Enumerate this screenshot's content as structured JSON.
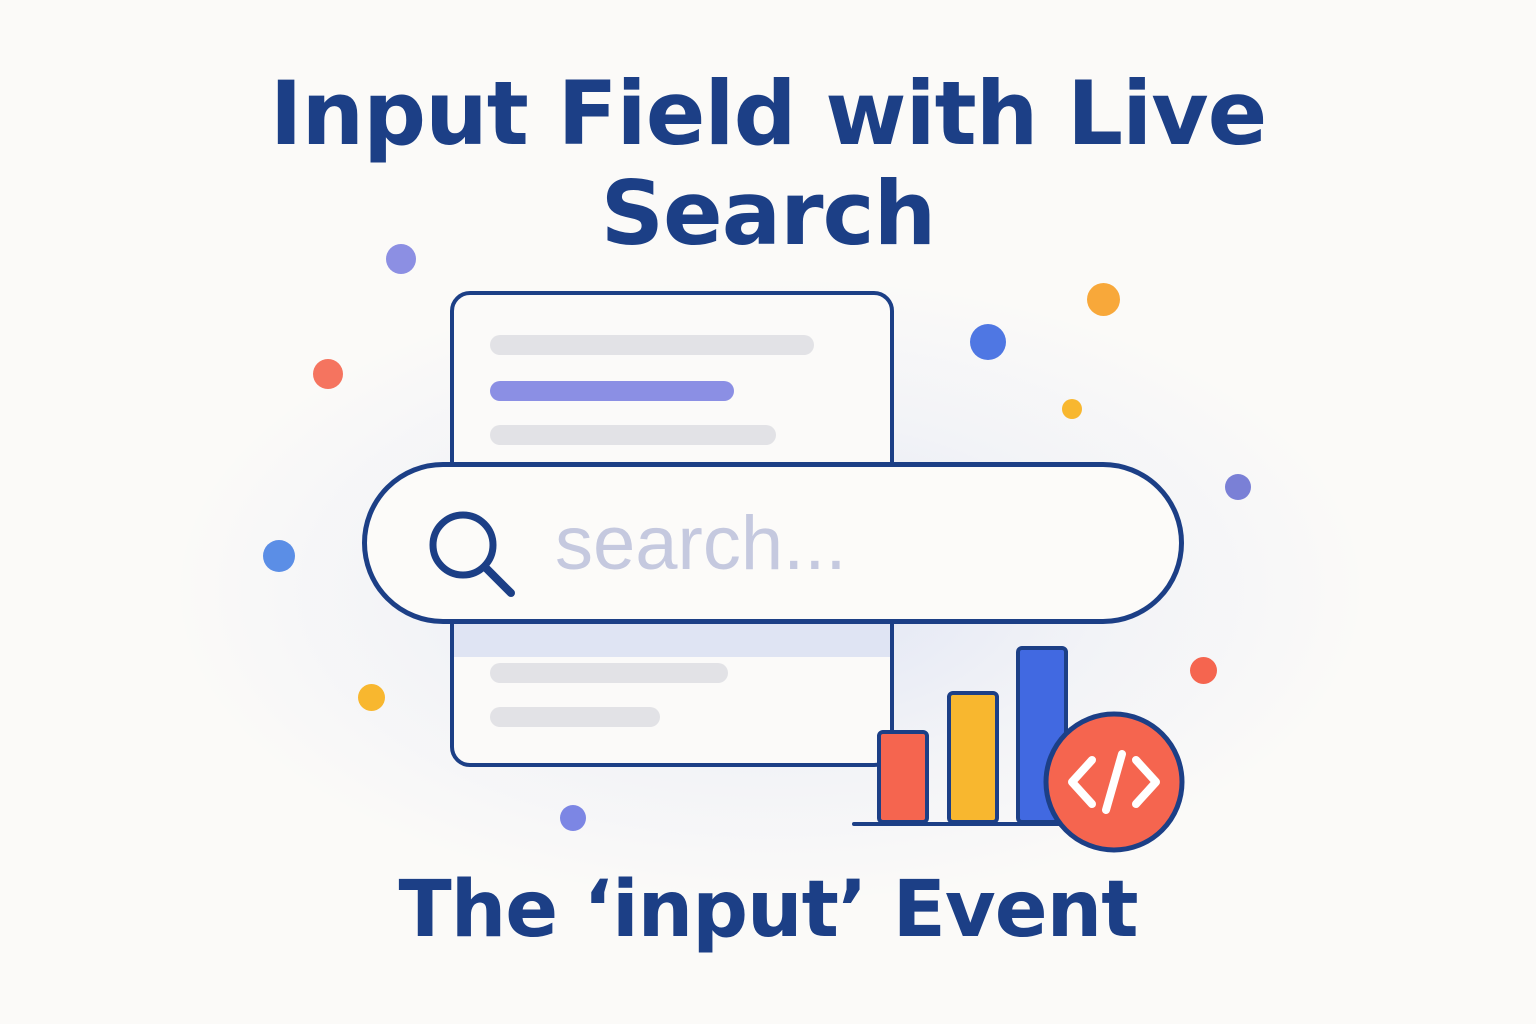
{
  "title": {
    "line1": "Input Field with Live",
    "line2": "Search"
  },
  "search": {
    "placeholder": "search..."
  },
  "subtitle": "The ‘input’ Event",
  "icons": {
    "search": "search-icon",
    "code": "code-icon",
    "chart": "bar-chart-icon"
  },
  "colors": {
    "navy": "#1c3f86",
    "placeholder": "#c5c9df",
    "highlight": "#8b8fe4",
    "bar_red": "#f5654f",
    "bar_yellow": "#f8b72f",
    "bar_blue": "#4169e1",
    "badge_red": "#f5654f"
  }
}
